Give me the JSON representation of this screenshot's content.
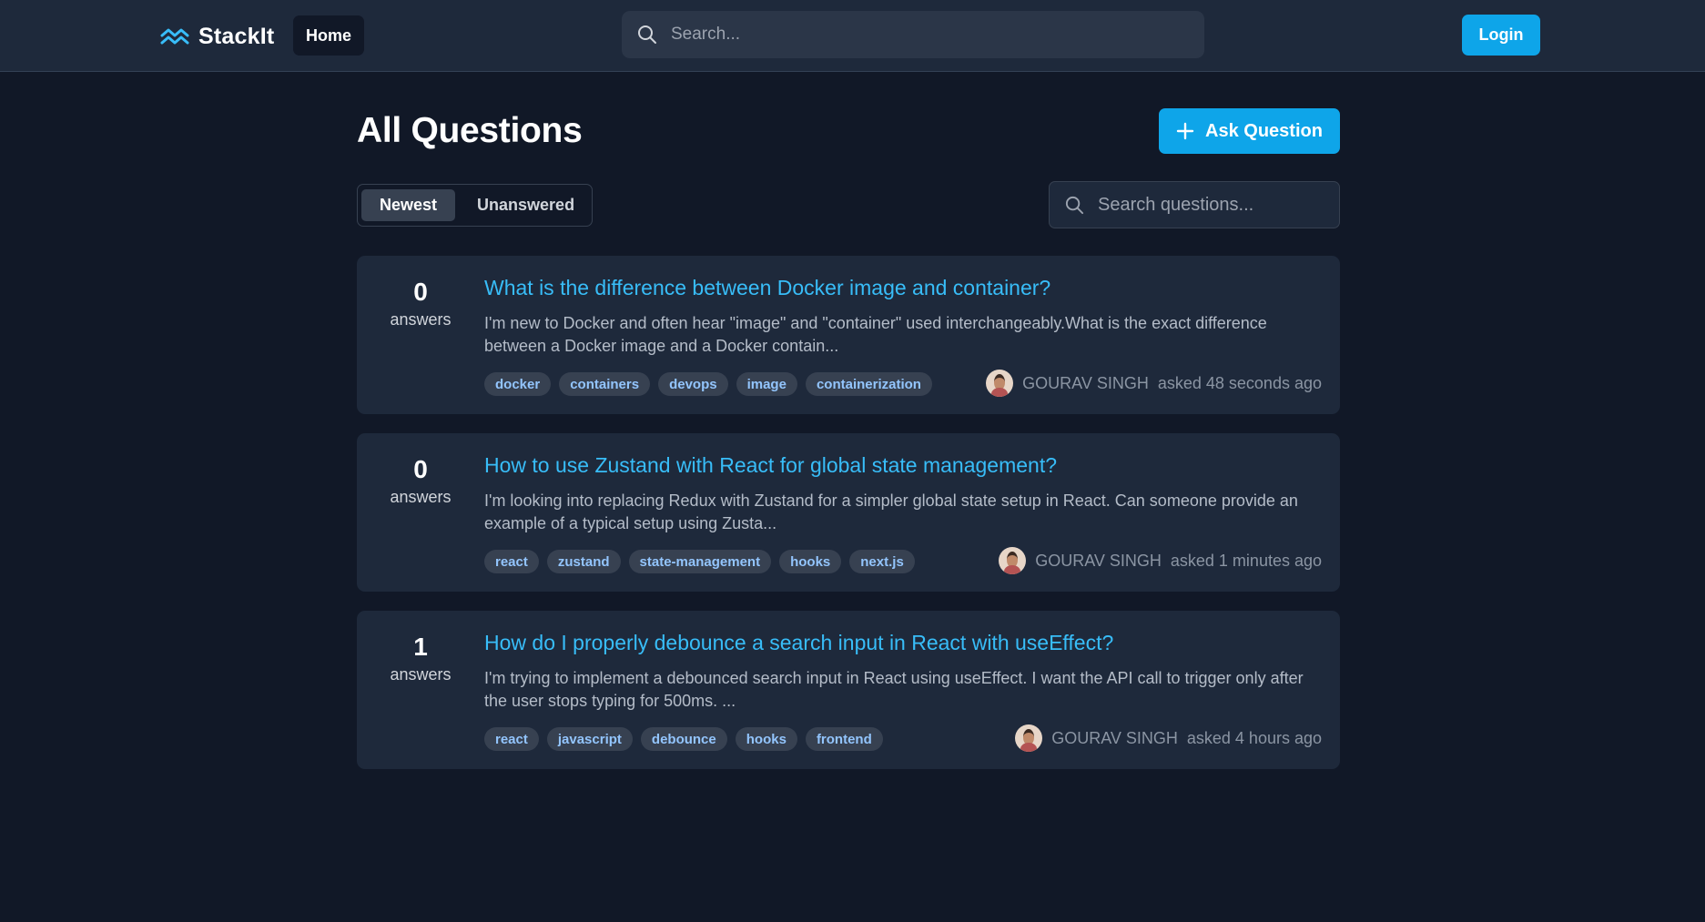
{
  "header": {
    "brand": "StackIt",
    "home_label": "Home",
    "search_placeholder": "Search...",
    "login_label": "Login"
  },
  "main": {
    "title": "All Questions",
    "ask_label": "Ask Question",
    "filters": [
      "Newest",
      "Unanswered"
    ],
    "active_filter": "Newest",
    "search_placeholder": "Search questions..."
  },
  "questions": [
    {
      "answers": "0",
      "answers_label": "answers",
      "title": "What is the difference between Docker image and container?",
      "excerpt": "I'm new to Docker and often hear \"image\" and \"container\" used interchangeably.What is the exact difference between a Docker image and a Docker contain...",
      "tags": [
        "docker",
        "containers",
        "devops",
        "image",
        "containerization"
      ],
      "author": "GOURAV SINGH",
      "asked": "asked 48 seconds ago"
    },
    {
      "answers": "0",
      "answers_label": "answers",
      "title": "How to use Zustand with React for global state management?",
      "excerpt": "I'm looking into replacing Redux with Zustand for a simpler global state setup in React. Can someone provide an example of a typical setup using Zusta...",
      "tags": [
        "react",
        "zustand",
        "state-management",
        "hooks",
        "next.js"
      ],
      "author": "GOURAV SINGH",
      "asked": "asked 1 minutes ago"
    },
    {
      "answers": "1",
      "answers_label": "answers",
      "title": "How do I properly debounce a search input in React with useEffect?",
      "excerpt": "I'm trying to implement a debounced search input in React using useEffect. I want the API call to trigger only after the user stops typing for 500ms. ...",
      "tags": [
        "react",
        "javascript",
        "debounce",
        "hooks",
        "frontend"
      ],
      "author": "GOURAV SINGH",
      "asked": "asked 4 hours ago"
    }
  ],
  "colors": {
    "accent": "#0ea5e9",
    "link": "#38bdf8",
    "background": "#111827",
    "card": "#1e293b"
  },
  "icons": {
    "brand": "stacked-chevrons-icon",
    "search": "search-icon",
    "ask": "plus-icon",
    "author": "avatar"
  }
}
